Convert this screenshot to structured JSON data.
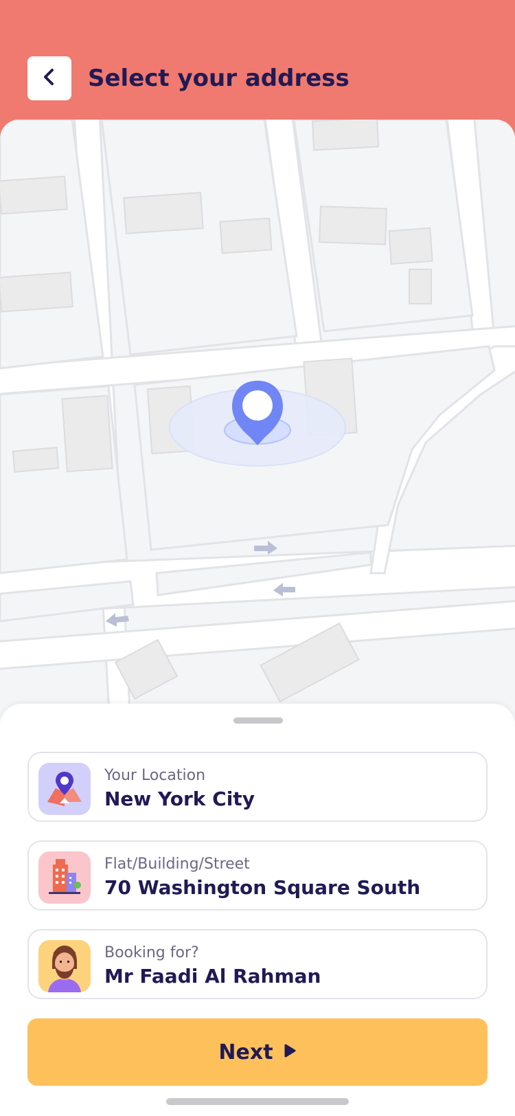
{
  "header": {
    "title": "Select your address",
    "back_icon": "chevron-left-icon",
    "background_color": "#f07a6f"
  },
  "map": {
    "marker_icon": "location-pin-icon",
    "marker_color": "#6f86f4"
  },
  "fields": [
    {
      "label": "Your Location",
      "value": "New York City",
      "icon": "map-pin-icon"
    },
    {
      "label": "Flat/Building/Street",
      "value": "70 Washington Square South",
      "icon": "building-icon"
    },
    {
      "label": "Booking for?",
      "value": "Mr Faadi Al Rahman",
      "icon": "avatar-icon"
    }
  ],
  "actions": {
    "next_label": "Next",
    "next_icon": "play-arrow-icon",
    "next_color": "#fec05a"
  }
}
